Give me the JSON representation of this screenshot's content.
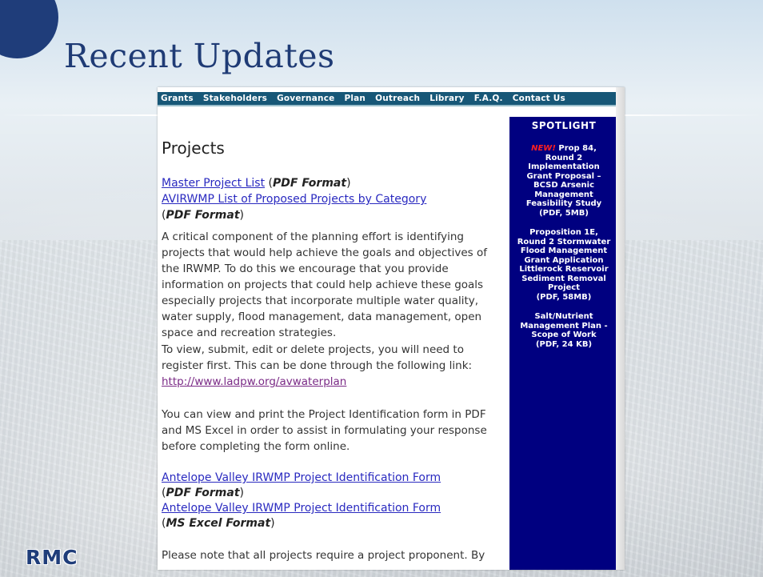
{
  "slide": {
    "title": "Recent Updates",
    "logo": "RMC"
  },
  "nav": {
    "items": [
      "Grants",
      "Stakeholders",
      "Governance",
      "Plan",
      "Outreach",
      "Library",
      "F.A.Q.",
      "Contact Us"
    ]
  },
  "page": {
    "heading": "Projects",
    "links": {
      "master_list": "Master Project List",
      "master_list_format": "PDF Format",
      "category_list": "AVIRWMP List of Proposed Projects by Category",
      "category_list_format": "PDF Format",
      "registration_url": "http://www.ladpw.org/avwaterplan",
      "form_pdf": "Antelope Valley IRWMP Project Identification Form",
      "form_pdf_format": "PDF Format",
      "form_excel": "Antelope Valley IRWMP Project Identification Form",
      "form_excel_format": "MS Excel Format"
    },
    "paragraphs": {
      "intro": "A critical component of the planning effort is identifying projects that would help achieve the goals and objectives of the IRWMP. To do this we encourage that you provide information on projects that could help achieve these goals especially projects that incorporate multiple water quality, water supply, flood management, data management, open space and recreation strategies.",
      "register": "To view, submit, edit or delete projects, you will need to register first. This can be done through the following link:",
      "print_form": "You can view and print the Project Identification form in PDF and MS Excel in order to assist in formulating your response before completing the form online.",
      "note": "Please note that all projects require a project proponent. By"
    }
  },
  "spotlight": {
    "title": "SPOTLIGHT",
    "new_tag": "NEW!",
    "item1_lines": [
      "Prop 84,",
      "Round 2",
      "Implementation",
      "Grant Proposal –",
      "BCSD Arsenic",
      "Management",
      "Feasibility Study",
      "(PDF, 5MB)"
    ],
    "item2_lines": [
      "Proposition 1E,",
      "Round 2 Stormwater",
      "Flood Management",
      "Grant Application",
      "Littlerock Reservoir",
      "Sediment Removal",
      "Project",
      "(PDF, 58MB)"
    ],
    "item3_lines": [
      "Salt/Nutrient",
      "Management Plan -",
      "Scope of Work",
      "(PDF, 24 KB)"
    ]
  },
  "colors": {
    "title": "#1f3b75",
    "nav_bg": "#175777",
    "spotlight_bg": "#000080",
    "new_tag": "#ff2020",
    "link": "#2a2ac0",
    "visited_link": "#7a2a86"
  }
}
